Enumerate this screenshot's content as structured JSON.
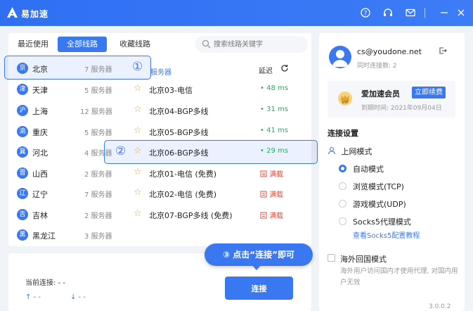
{
  "app": {
    "name": "易加速"
  },
  "titlebar": {
    "icons": [
      "help-icon",
      "headset-icon",
      "mail-icon",
      "minimize-icon",
      "close-icon"
    ]
  },
  "tabs": [
    {
      "label": "最近使用",
      "active": false
    },
    {
      "label": "全部线路",
      "active": true
    },
    {
      "label": "收藏线路",
      "active": false
    }
  ],
  "search": {
    "placeholder": "搜索线路关键字"
  },
  "regions": [
    {
      "badge": "京",
      "name": "北京",
      "count": "7 服务器"
    },
    {
      "badge": "津",
      "name": "天津",
      "count": "5 服务器"
    },
    {
      "badge": "沪",
      "name": "上海",
      "count": "12 服务器"
    },
    {
      "badge": "渝",
      "name": "重庆",
      "count": "5 服务器"
    },
    {
      "badge": "冀",
      "name": "河北",
      "count": "4 服务器"
    },
    {
      "badge": "晋",
      "name": "山西",
      "count": "2 服务器"
    },
    {
      "badge": "辽",
      "name": "辽宁",
      "count": "7 服务器"
    },
    {
      "badge": "吉",
      "name": "吉林",
      "count": "2 服务器"
    },
    {
      "badge": "黑",
      "name": "黑龙江",
      "count": "3 服务器"
    }
  ],
  "server_header": {
    "label": "服务器",
    "latency": "延迟"
  },
  "servers": [
    {
      "name": "北京03-电信",
      "status": "• 48 ms",
      "full": false
    },
    {
      "name": "北京04-BGP多线",
      "status": "• 31 ms",
      "full": false
    },
    {
      "name": "北京05-BGP多线",
      "status": "• 41 ms",
      "full": false
    },
    {
      "name": "北京06-BGP多线",
      "status": "• 29 ms",
      "full": false
    },
    {
      "name": "北京01-电信 (免费)",
      "status": "满载",
      "full": true
    },
    {
      "name": "北京02-电信 (免费)",
      "status": "满载",
      "full": true
    },
    {
      "name": "北京07-BGP多线 (免费)",
      "status": "满载",
      "full": true
    }
  ],
  "annotations": {
    "step1": "①",
    "step2": "②",
    "step3": "③ 点击“连接”即可"
  },
  "connection": {
    "current_label": "当前连接: - -",
    "up": "↑ - -",
    "down": "↓ - -",
    "connect_label": "连接"
  },
  "account": {
    "email": "cs@youdone.net",
    "connections": "同时连接数: 2",
    "vip_name": "爱加速会员",
    "renew_label": "立即续费",
    "expire": "到期时间: 2021年09月04日"
  },
  "settings": {
    "title": "连接设置",
    "mode_title": "上网模式",
    "modes": [
      {
        "label": "自动模式",
        "selected": true
      },
      {
        "label": "浏览模式(TCP)",
        "selected": false
      },
      {
        "label": "游戏模式(UDP)",
        "selected": false
      },
      {
        "label": "Socks5代理模式",
        "selected": false
      }
    ],
    "socks_link": "查看Socks5配置教程",
    "overseas_label": "海外回国模式",
    "overseas_desc": "海外用户访问国内才使用代理, 对国内用户无效"
  },
  "version": "3.0.0.2",
  "colors": {
    "accent": "#3a78f2",
    "latency_good": "#27ae60",
    "full_load": "#e74c3c",
    "star": "#f5a623"
  }
}
